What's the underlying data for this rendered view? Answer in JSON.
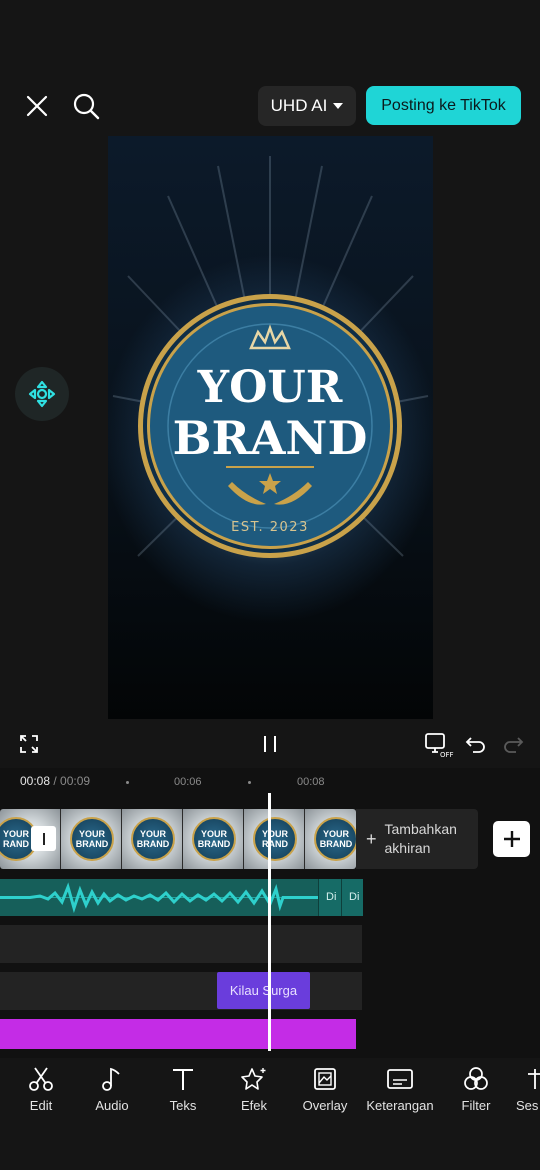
{
  "header": {
    "uhd_label": "UHD AI",
    "post_label": "Posting ke TikTok"
  },
  "preview": {
    "logo_line1": "YOUR",
    "logo_line2": "BRAND",
    "logo_est": "EST. 2023"
  },
  "timeline": {
    "current_time": "00:08",
    "total_time": "/ 00:09",
    "ticks": [
      "00:06",
      "00:08"
    ],
    "add_ending_line1": "Tambahkan",
    "add_ending_line2": "akhiran",
    "thumb_line1": "YOUR",
    "thumb_line2": "BRAND",
    "thumb_partial1": "YOUR",
    "thumb_partial2": "RAND",
    "audio_segments": [
      "Di",
      "Di"
    ],
    "effect_clip_label": "Kilau Surga"
  },
  "toolbar": {
    "items": [
      {
        "label": "Edit",
        "icon": "scissors-icon"
      },
      {
        "label": "Audio",
        "icon": "music-note-icon"
      },
      {
        "label": "Teks",
        "icon": "text-icon"
      },
      {
        "label": "Efek",
        "icon": "sparkle-star-icon"
      },
      {
        "label": "Overlay",
        "icon": "overlay-icon"
      },
      {
        "label": "Keterangan",
        "icon": "captions-icon"
      },
      {
        "label": "Filter",
        "icon": "filter-icon"
      },
      {
        "label": "Ses",
        "icon": "adjust-icon"
      }
    ]
  },
  "colors": {
    "accent": "#1fd5d6",
    "effect_clip": "#6a3ddc",
    "text_clip": "#c42ce6",
    "audio_track": "#165f5a"
  }
}
